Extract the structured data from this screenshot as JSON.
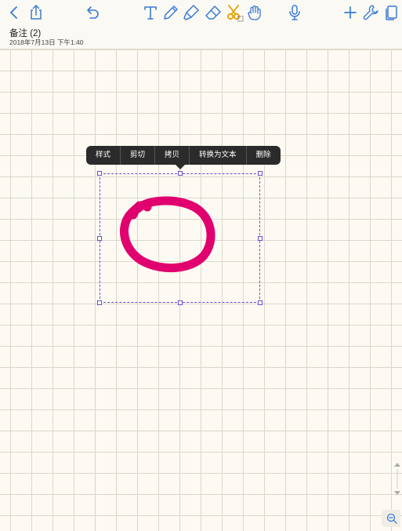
{
  "note": {
    "title": "备注 (2)",
    "date": "2018年7月13日 下午1:40"
  },
  "context_menu": {
    "items": [
      "样式",
      "剪切",
      "拷贝",
      "转换为文本",
      "删除"
    ]
  },
  "ink": {
    "color": "#e0006e"
  },
  "selection": {
    "color": "#6d4ccf"
  },
  "icons": {
    "back": "chevron-left-icon",
    "share": "share-icon",
    "undo": "undo-icon",
    "text": "text-tool-icon",
    "pen": "pen-icon",
    "highlighter": "highlighter-icon",
    "eraser": "eraser-icon",
    "lasso": "lasso-scissors-icon",
    "hand": "hand-tool-icon",
    "mic": "microphone-icon",
    "add": "plus-icon",
    "settings": "wrench-icon",
    "pages": "pages-icon",
    "zoom": "zoom-icon"
  },
  "colors": {
    "accent": "#3a7bd5",
    "lasso": "#e6a100"
  }
}
